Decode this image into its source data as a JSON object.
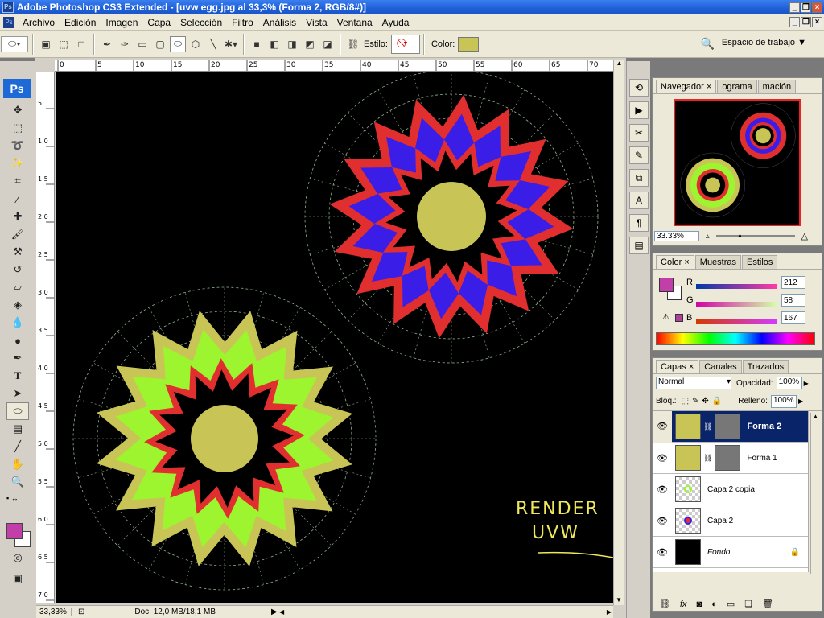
{
  "window": {
    "title": "Adobe Photoshop CS3 Extended - [uvw egg.jpg al 33,3% (Forma 2, RGB/8#)]",
    "app_badge": "Ps"
  },
  "menu": [
    "Archivo",
    "Edición",
    "Imagen",
    "Capa",
    "Selección",
    "Filtro",
    "Análisis",
    "Vista",
    "Ventana",
    "Ayuda"
  ],
  "options": {
    "style_label": "Estilo:",
    "color_label": "Color:",
    "color_value": "#c8c455",
    "workspace": "Espacio de trabajo"
  },
  "toolbox": {
    "logo": "Ps"
  },
  "ruler_top": [
    "0",
    "5",
    "10",
    "15",
    "20",
    "25",
    "30",
    "35",
    "40",
    "45",
    "50",
    "55",
    "60",
    "65",
    "70"
  ],
  "ruler_left": [
    "5",
    "1 0",
    "1 5",
    "2 0",
    "2 5",
    "3 0",
    "3 5",
    "4 0",
    "4 5",
    "5 0",
    "5 5",
    "6 0",
    "6 5",
    "7 0"
  ],
  "canvas": {
    "annotation_line1": "RENDER",
    "annotation_line2": "UVW",
    "colors": {
      "yellow": "#c8c455",
      "red": "#e12f2f",
      "blue": "#3a1ee8",
      "green": "#9cf52e"
    }
  },
  "status": {
    "zoom": "33,33%",
    "doc": "Doc: 12,0 MB/18,1 MB"
  },
  "navigator": {
    "tabs": [
      "Navegador",
      "ograma",
      "mación"
    ],
    "zoom": "33.33%"
  },
  "color_panel": {
    "tabs": [
      "Color",
      "Muestras",
      "Estilos"
    ],
    "r_label": "R",
    "g_label": "G",
    "b_label": "B",
    "r": "212",
    "g": "58",
    "b": "167",
    "fg": "#d43aa7"
  },
  "layers_panel": {
    "tabs": [
      "Capas",
      "Canales",
      "Trazados"
    ],
    "blend_mode": "Normal",
    "opacity_label": "Opacidad:",
    "opacity": "100%",
    "lock_label": "Bloq.:",
    "fill_label": "Relleno:",
    "fill": "100%",
    "layers": [
      {
        "name": "Forma 2",
        "selected": true
      },
      {
        "name": "Forma 1",
        "selected": false
      },
      {
        "name": "Capa 2 copia",
        "selected": false
      },
      {
        "name": "Capa 2",
        "selected": false
      },
      {
        "name": "Fondo",
        "selected": false
      }
    ]
  }
}
